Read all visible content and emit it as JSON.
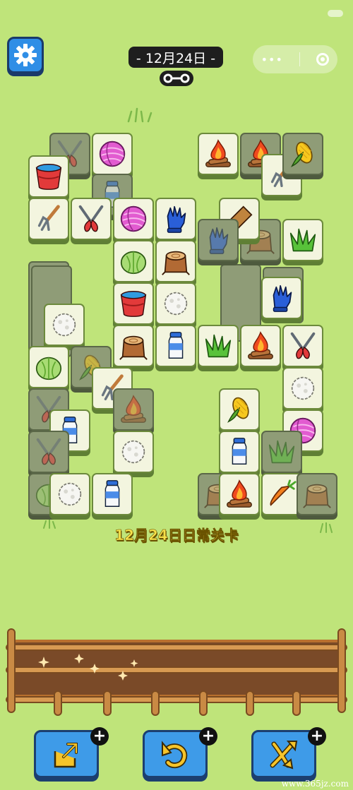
{
  "header": {
    "date_label": "- 12月24日 -"
  },
  "level": {
    "label": "12月24日日常关卡"
  },
  "watermark": "www.365jz.com",
  "colors": {
    "background": "#bfe47a",
    "tile_face": "#f3f5df",
    "tile_dimmed": "#8f9c77",
    "button_blue": "#3e9be8",
    "tray_brown": "#7a4a28",
    "level_text": "#f6e04a"
  },
  "toolbar": {
    "buttons": [
      {
        "icon": "move-out-icon"
      },
      {
        "icon": "undo-icon"
      },
      {
        "icon": "shuffle-icon"
      }
    ]
  },
  "board": {
    "tiles": [
      {
        "icon": "shears-icon",
        "state": "dimmed"
      },
      {
        "icon": "yarn-ball-icon",
        "state": "covered"
      },
      {
        "icon": "bucket-icon",
        "state": "free"
      },
      {
        "icon": "milk-bottle-icon",
        "state": "dimmed"
      },
      {
        "icon": "rake-icon",
        "state": "free"
      },
      {
        "icon": "shears-icon",
        "state": "free"
      },
      {
        "icon": "yarn-ball-icon",
        "state": "free"
      },
      {
        "icon": "glove-icon",
        "state": "free"
      },
      {
        "icon": "cabbage-icon",
        "state": "free"
      },
      {
        "icon": "tree-stump-icon",
        "state": "free"
      },
      {
        "icon": "bucket-icon",
        "state": "free"
      },
      {
        "icon": "cotton-icon",
        "state": "free"
      },
      {
        "icon": "cotton-icon",
        "state": "free"
      },
      {
        "icon": "tree-stump-icon",
        "state": "free"
      },
      {
        "icon": "milk-bottle-icon",
        "state": "free"
      },
      {
        "icon": "grass-icon",
        "state": "free"
      },
      {
        "icon": "campfire-icon",
        "state": "free"
      },
      {
        "icon": "shears-icon",
        "state": "free"
      },
      {
        "icon": "cabbage-icon",
        "state": "free"
      },
      {
        "icon": "corn-icon",
        "state": "dimmed"
      },
      {
        "icon": "rake-icon",
        "state": "free"
      },
      {
        "icon": "shears-icon",
        "state": "dimmed"
      },
      {
        "icon": "campfire-icon",
        "state": "dimmed"
      },
      {
        "icon": "milk-bottle-icon",
        "state": "free"
      },
      {
        "icon": "cotton-icon",
        "state": "free"
      },
      {
        "icon": "shears-icon",
        "state": "dimmed"
      },
      {
        "icon": "cotton-icon",
        "state": "free"
      },
      {
        "icon": "milk-bottle-icon",
        "state": "free"
      },
      {
        "icon": "campfire-icon",
        "state": "free"
      },
      {
        "icon": "campfire-icon",
        "state": "free"
      },
      {
        "icon": "rake-icon",
        "state": "free"
      },
      {
        "icon": "corn-icon",
        "state": "free"
      },
      {
        "icon": "tree-stump-icon",
        "state": "dimmed"
      },
      {
        "icon": "grass-icon",
        "state": "free"
      },
      {
        "icon": "brush-icon",
        "state": "free"
      },
      {
        "icon": "glove-icon",
        "state": "dimmed"
      },
      {
        "icon": "glove-icon",
        "state": "free"
      },
      {
        "icon": "cotton-icon",
        "state": "free"
      },
      {
        "icon": "corn-icon",
        "state": "free"
      },
      {
        "icon": "yarn-ball-icon",
        "state": "free"
      },
      {
        "icon": "milk-bottle-icon",
        "state": "free"
      },
      {
        "icon": "grass-icon",
        "state": "dimmed"
      },
      {
        "icon": "tree-stump-icon",
        "state": "dimmed"
      },
      {
        "icon": "campfire-icon",
        "state": "free"
      },
      {
        "icon": "carrot-icon",
        "state": "free"
      },
      {
        "icon": "tree-stump-icon",
        "state": "dimmed"
      },
      {
        "icon": "cabbage-icon",
        "state": "dimmed"
      }
    ]
  }
}
